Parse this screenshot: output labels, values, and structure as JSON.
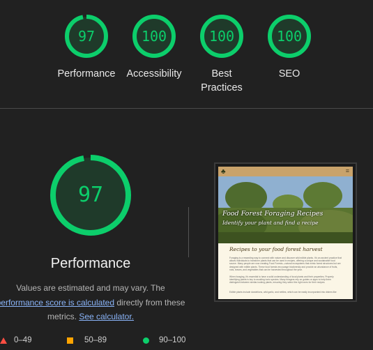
{
  "colors": {
    "pass": "#0cce6b",
    "average": "#ffa400",
    "fail": "#ff4e42",
    "link": "#8ab4f8"
  },
  "categories": [
    {
      "label": "Performance",
      "score": 97
    },
    {
      "label": "Accessibility",
      "score": 100
    },
    {
      "label": "Best Practices",
      "score": 100
    },
    {
      "label": "SEO",
      "score": 100
    }
  ],
  "performance": {
    "score": 97,
    "title": "Performance",
    "desc_prefix": "Values are estimated and may vary. The",
    "desc_link": "performance score is calculated",
    "desc_mid": "directly from these metrics.",
    "calc_link": "See calculator."
  },
  "legend": [
    {
      "range": "0–49",
      "icon": "red-triangle-icon"
    },
    {
      "range": "50–89",
      "icon": "orange-square-icon"
    },
    {
      "range": "90–100",
      "icon": "green-circle-icon"
    }
  ],
  "screenshot": {
    "hero_title": "Food Forest Foraging Recipes",
    "hero_subtitle": "Identify your plant and find a recipe",
    "page_heading": "Recipes to your food forest harvest",
    "para1": "Foraging is a rewarding way to connect with nature and discover wild edible plants. It's an ancient practice that allows individuals to transform plants that can be used in recipes, offering a unique and sustainable food source. Many people are now creating Food Forests—natural ecosystems that mimic forest structures but are designed with edible plants. These food forests encourage biodiversity and provide an abundance of fruits, nuts, leaves, and vegetables that can be harvested throughout the year.",
    "para2": "When foraging, it's essential to have a solid understanding of local plants and their properties. Properly identifying plants is key to avoiding toxic species. Many foragers rely on guides or apps to help them distinguish between similar-looking plants, ensuring they select the right ones for their recipes.",
    "para3": "Edible plants include dandelions, wild garlic, and nettles, which can be easily incorporated into dishes like"
  }
}
